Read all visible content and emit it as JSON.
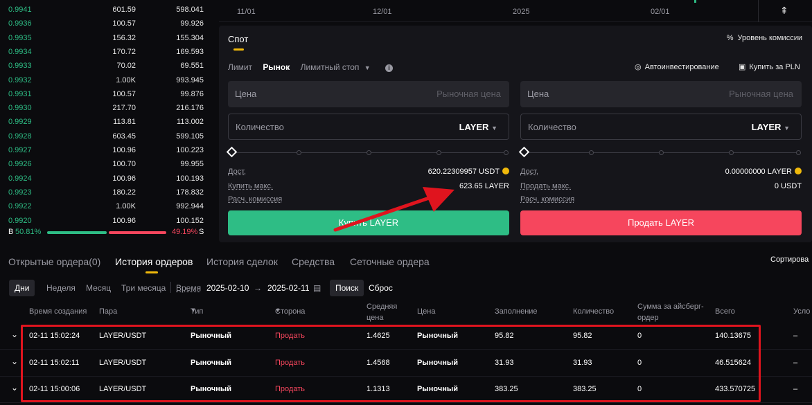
{
  "order_book": {
    "rows": [
      {
        "price": "0.9941",
        "amount": "601.59",
        "total": "598.041"
      },
      {
        "price": "0.9936",
        "amount": "100.57",
        "total": "99.926"
      },
      {
        "price": "0.9935",
        "amount": "156.32",
        "total": "155.304"
      },
      {
        "price": "0.9934",
        "amount": "170.72",
        "total": "169.593"
      },
      {
        "price": "0.9933",
        "amount": "70.02",
        "total": "69.551"
      },
      {
        "price": "0.9932",
        "amount": "1.00K",
        "total": "993.945"
      },
      {
        "price": "0.9931",
        "amount": "100.57",
        "total": "99.876"
      },
      {
        "price": "0.9930",
        "amount": "217.70",
        "total": "216.176"
      },
      {
        "price": "0.9929",
        "amount": "113.81",
        "total": "113.002"
      },
      {
        "price": "0.9928",
        "amount": "603.45",
        "total": "599.105"
      },
      {
        "price": "0.9927",
        "amount": "100.96",
        "total": "100.223"
      },
      {
        "price": "0.9926",
        "amount": "100.70",
        "total": "99.955"
      },
      {
        "price": "0.9924",
        "amount": "100.96",
        "total": "100.193"
      },
      {
        "price": "0.9923",
        "amount": "180.22",
        "total": "178.832"
      },
      {
        "price": "0.9922",
        "amount": "1.00K",
        "total": "992.944"
      },
      {
        "price": "0.9920",
        "amount": "100.96",
        "total": "100.152"
      }
    ],
    "buy_label": "B",
    "buy_pct": "50.81%",
    "sell_pct": "49.19%",
    "sell_label": "S",
    "buy_ratio": 0.5081
  },
  "chart_axis": {
    "ticks": [
      "11/01",
      "12/01",
      "2025",
      "02/01"
    ]
  },
  "trade": {
    "spot_tab": "Спот",
    "fee_level": "Уровень комиссии",
    "order_types": [
      "Лимит",
      "Рынок",
      "Лимитный стоп"
    ],
    "active_type": "Рынок",
    "auto_invest": "Автоинвестирование",
    "buy_pln": "Купить за PLN",
    "buy": {
      "price_label": "Цена",
      "price_placeholder": "Рыночная цена",
      "qty_label": "Количество",
      "qty_unit": "LAYER",
      "avail_label": "Дост.",
      "avail_value": "620.22309957 USDT",
      "max_label": "Купить макс.",
      "max_value": "623.65 LAYER",
      "fee_label": "Расч. комиссия",
      "button": "Купить LAYER"
    },
    "sell": {
      "price_label": "Цена",
      "price_placeholder": "Рыночная цена",
      "qty_label": "Количество",
      "qty_unit": "LAYER",
      "avail_label": "Дост.",
      "avail_value": "0.00000000 LAYER",
      "max_label": "Продать макс.",
      "max_value": "0 USDT",
      "fee_label": "Расч. комиссия",
      "button": "Продать LAYER"
    }
  },
  "bottom": {
    "tabs": [
      "Открытые ордера(0)",
      "История ордеров",
      "История сделок",
      "Средства",
      "Сеточные ордера"
    ],
    "active_tab": "История ордеров",
    "sort_label": "Сортирова",
    "periods": [
      "Дни",
      "Неделя",
      "Месяц",
      "Три месяца"
    ],
    "active_period": "Дни",
    "time_label": "Время",
    "date_from": "2025-02-10",
    "date_to": "2025-02-11",
    "search": "Поиск",
    "reset": "Сброс",
    "columns": [
      "Время создания",
      "Пара",
      "Тип",
      "Сторона",
      "Средняя цена",
      "Цена",
      "Заполнение",
      "Количество",
      "Сумма за айсберг-ордер",
      "Всего",
      "Усло"
    ],
    "rows": [
      {
        "time": "02-11 15:02:24",
        "pair": "LAYER/USDT",
        "type": "Рыночный",
        "side": "Продать",
        "avg": "1.4625",
        "price": "Рыночный",
        "filled": "95.82",
        "qty": "95.82",
        "iceberg": "0",
        "total": "140.13675",
        "cond": "–"
      },
      {
        "time": "02-11 15:02:11",
        "pair": "LAYER/USDT",
        "type": "Рыночный",
        "side": "Продать",
        "avg": "1.4568",
        "price": "Рыночный",
        "filled": "31.93",
        "qty": "31.93",
        "iceberg": "0",
        "total": "46.515624",
        "cond": "–"
      },
      {
        "time": "02-11 15:00:06",
        "pair": "LAYER/USDT",
        "type": "Рыночный",
        "side": "Продать",
        "avg": "1.1313",
        "price": "Рыночный",
        "filled": "383.25",
        "qty": "383.25",
        "iceberg": "0",
        "total": "433.570725",
        "cond": "–"
      }
    ]
  },
  "colors": {
    "buy": "#2ebd85",
    "sell": "#f6465d",
    "accent": "#f0b90b",
    "highlight": "#e0141e"
  }
}
